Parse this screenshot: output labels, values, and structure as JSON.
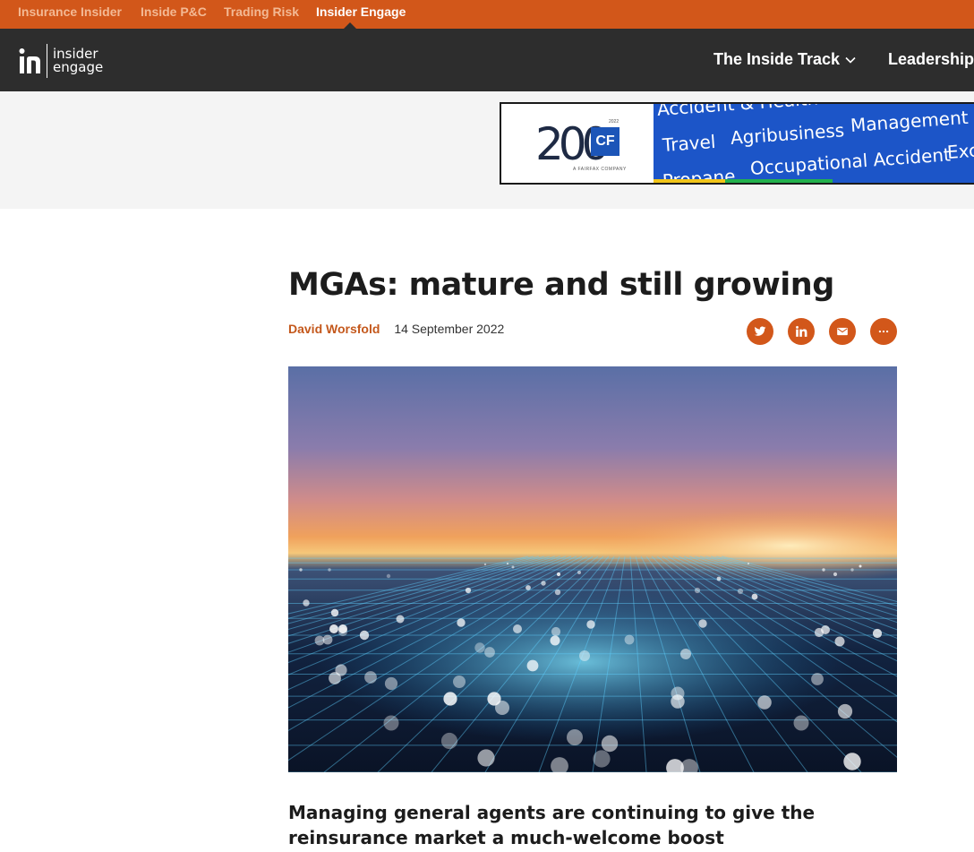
{
  "brand_bar": {
    "items": [
      {
        "label": "Insurance Insider",
        "active": false
      },
      {
        "label": "Inside P&C",
        "active": false
      },
      {
        "label": "Trading Risk",
        "active": false
      },
      {
        "label": "Insider Engage",
        "active": true
      }
    ]
  },
  "logo": {
    "mark": "in",
    "line1": "insider",
    "line2": "engage"
  },
  "nav": {
    "items": [
      {
        "label": "The Inside Track",
        "has_dropdown": true
      },
      {
        "label": "Leadership",
        "has_dropdown": false
      }
    ]
  },
  "ad": {
    "logo_number": "200",
    "logo_badge": "CF",
    "logo_year": "2022",
    "logo_subtext": "A FAIRFAX COMPANY",
    "words": [
      "Accident & Health",
      "Travel",
      "Agribusiness",
      "Management Li",
      "Exc",
      "Propane",
      "Occupational Accident"
    ]
  },
  "article": {
    "title": "MGAs: mature and still growing",
    "author": "David Worsfold",
    "date": "14 September 2022",
    "standfirst": "Managing general agents are continuing to give the reinsurance market a much-welcome boost"
  },
  "share": {
    "buttons": [
      "twitter-icon",
      "linkedin-icon",
      "email-icon",
      "more-icon"
    ]
  },
  "colors": {
    "accent": "#d2571a",
    "nav_bg": "#2d2d2d",
    "author": "#c4581c",
    "ad_blue": "#1c55c8"
  }
}
